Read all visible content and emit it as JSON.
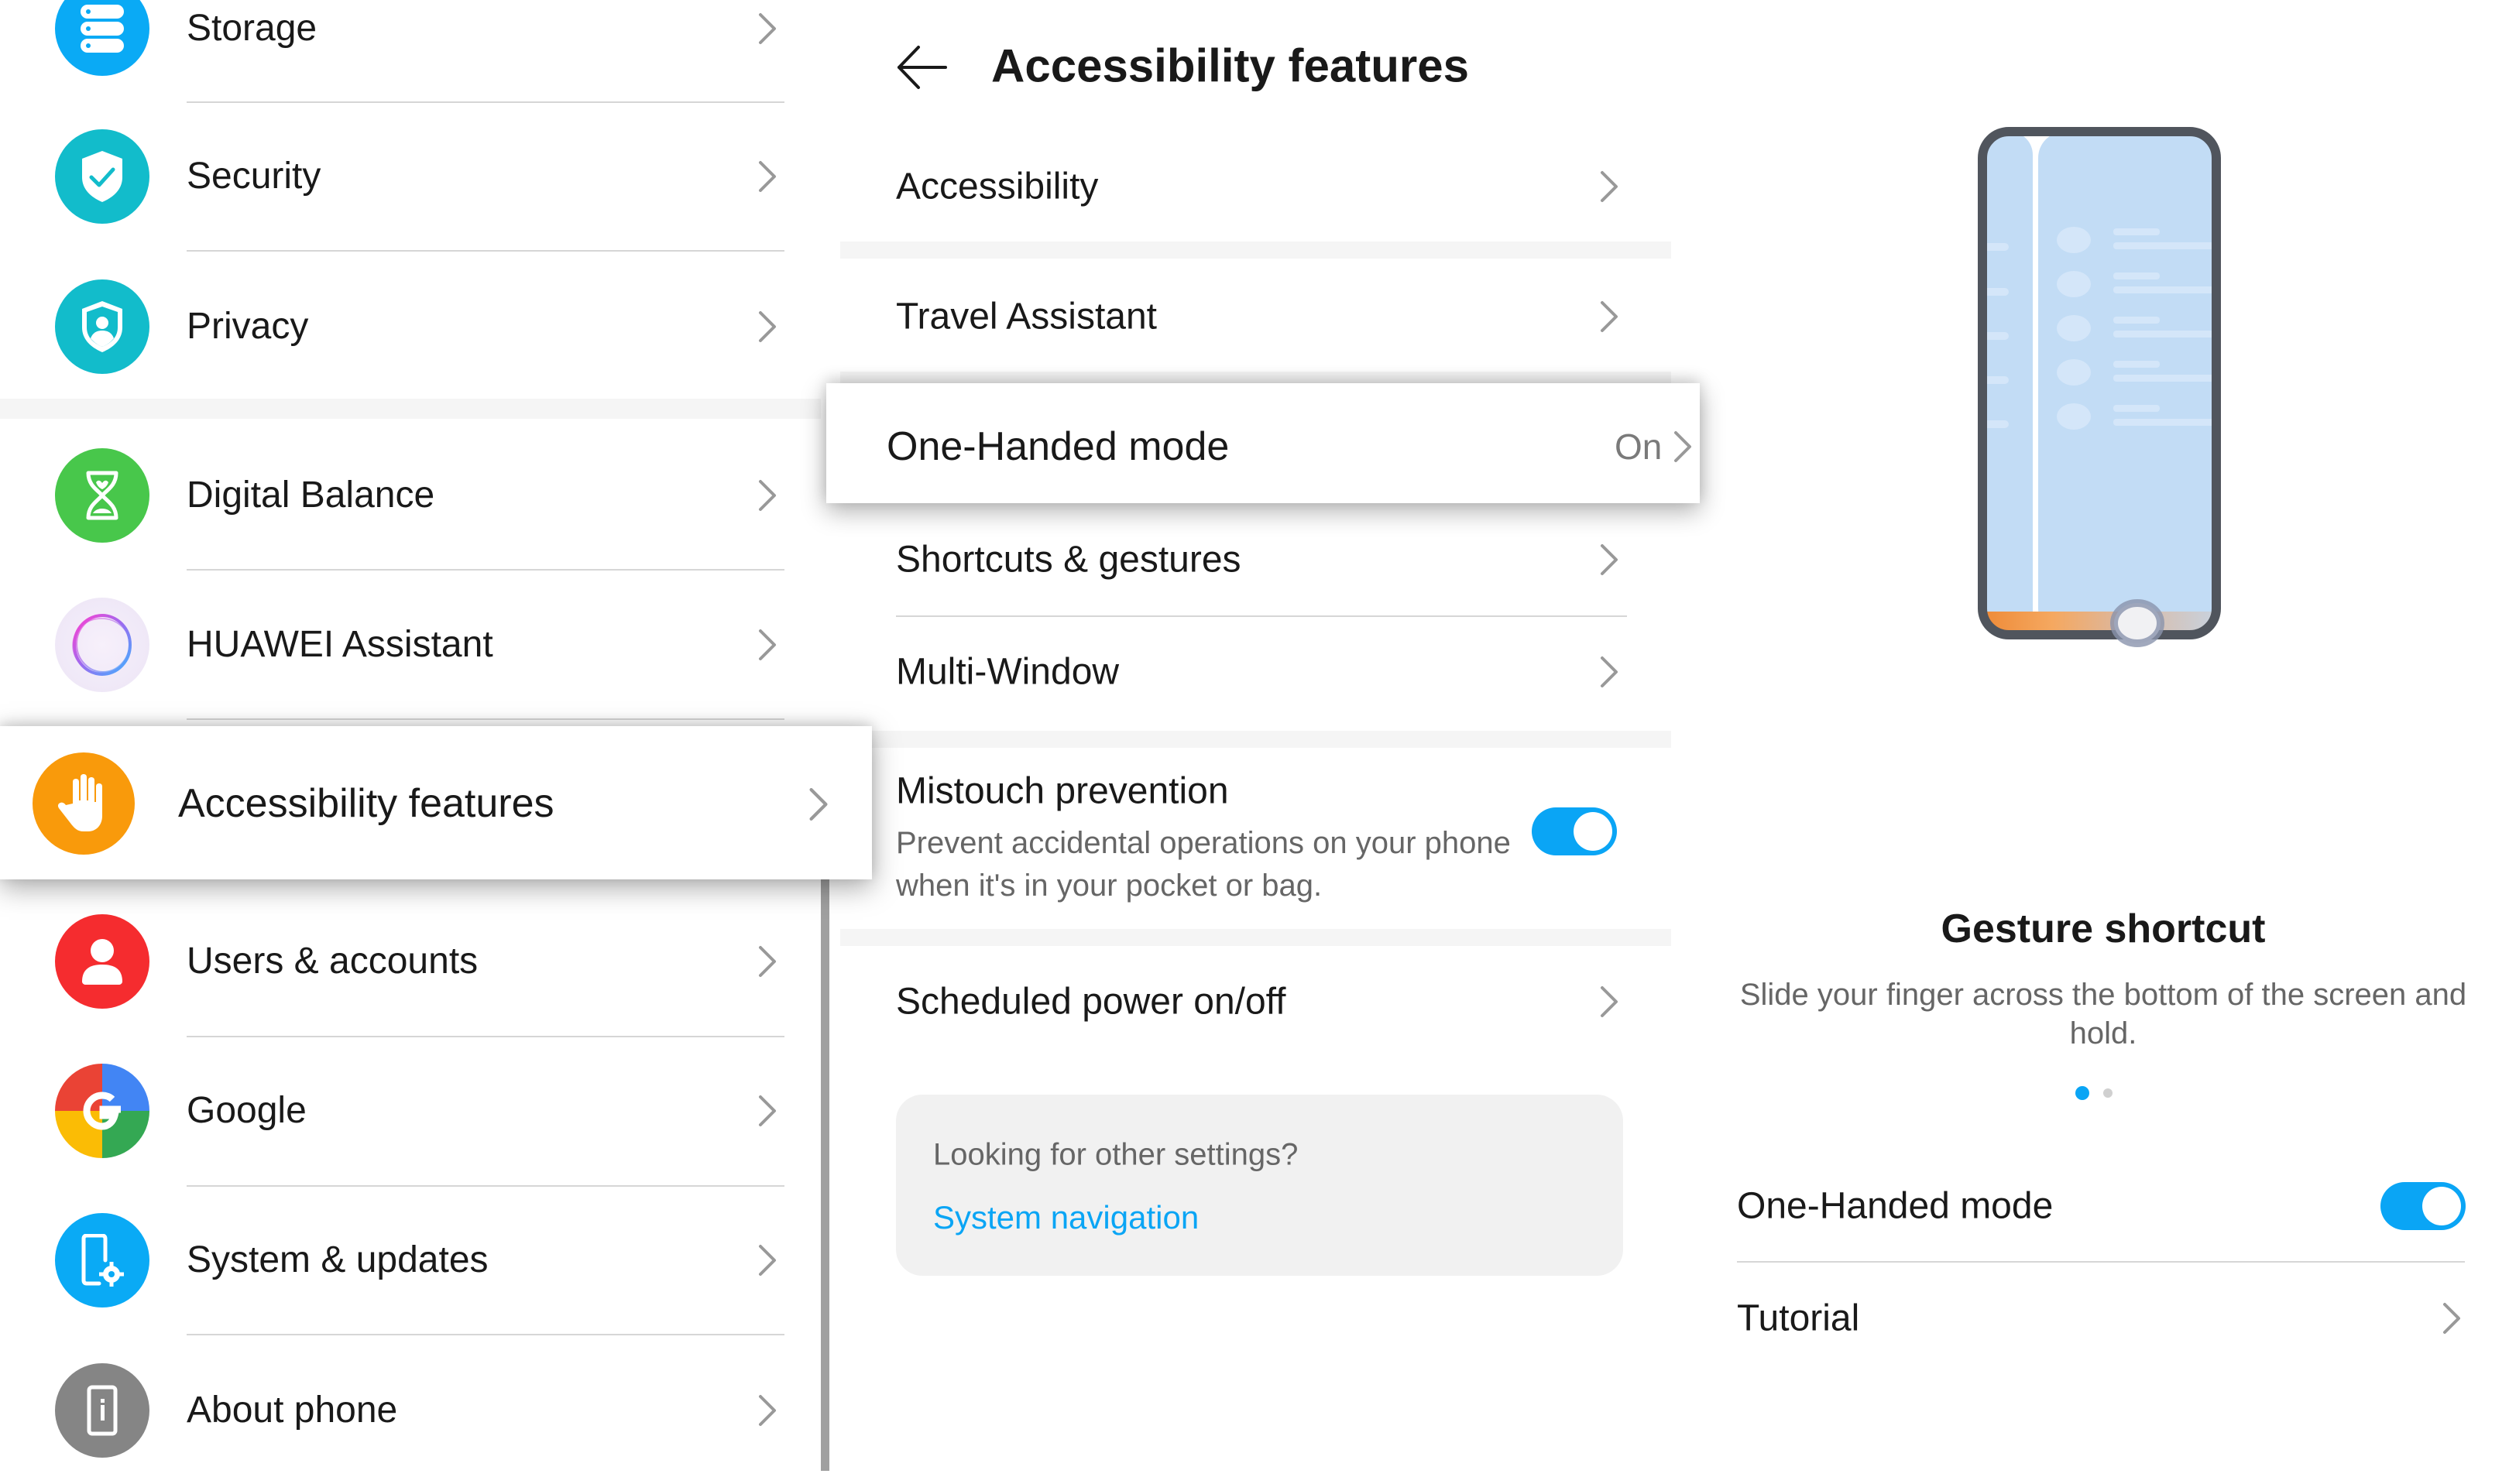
{
  "left_panel": {
    "items": [
      {
        "label": "Storage",
        "icon": "storage-icon",
        "color": "#0aaaf5"
      },
      {
        "label": "Security",
        "icon": "shield-check-icon",
        "color": "#12bccb"
      },
      {
        "label": "Privacy",
        "icon": "shield-user-icon",
        "color": "#12bccb"
      },
      {
        "label": "Digital Balance",
        "icon": "hourglass-icon",
        "color": "#48c74b"
      },
      {
        "label": "HUAWEI Assistant",
        "icon": "assistant-ring-icon",
        "color": "#f3eefb"
      },
      {
        "label": "Accessibility features",
        "icon": "hand-icon",
        "color": "#f99a0b",
        "selected": true
      },
      {
        "label": "Users & accounts",
        "icon": "user-icon",
        "color": "#f52c2f"
      },
      {
        "label": "Google",
        "icon": "google-icon",
        "color": "#4285f4"
      },
      {
        "label": "System & updates",
        "icon": "phone-gear-icon",
        "color": "#0aaaf5"
      },
      {
        "label": "About phone",
        "icon": "phone-info-icon",
        "color": "#858585"
      }
    ]
  },
  "middle_panel": {
    "title": "Accessibility features",
    "items": [
      {
        "label": "Accessibility"
      },
      {
        "label": "Travel Assistant"
      },
      {
        "label": "One-Handed mode",
        "value": "On",
        "highlighted": true
      },
      {
        "label": "Shortcuts & gestures"
      },
      {
        "label": "Multi-Window"
      },
      {
        "label": "Mistouch prevention",
        "description": "Prevent accidental operations on your phone when it's in your pocket or bag.",
        "toggle": true
      },
      {
        "label": "Scheduled power on/off"
      }
    ],
    "card": {
      "hint": "Looking for other settings?",
      "link": "System navigation"
    }
  },
  "right_panel": {
    "gesture_title": "Gesture shortcut",
    "gesture_description": "Slide your finger across the bottom of the screen and hold.",
    "page_indicator": {
      "current": 1,
      "total": 2
    },
    "one_handed_label": "One-Handed mode",
    "one_handed_enabled": true,
    "tutorial_label": "Tutorial"
  },
  "colors": {
    "accent": "#0aa5f5",
    "text_primary": "#191919",
    "text_secondary": "#666666",
    "chevron": "#999999",
    "section_gap": "#f5f5f5"
  }
}
